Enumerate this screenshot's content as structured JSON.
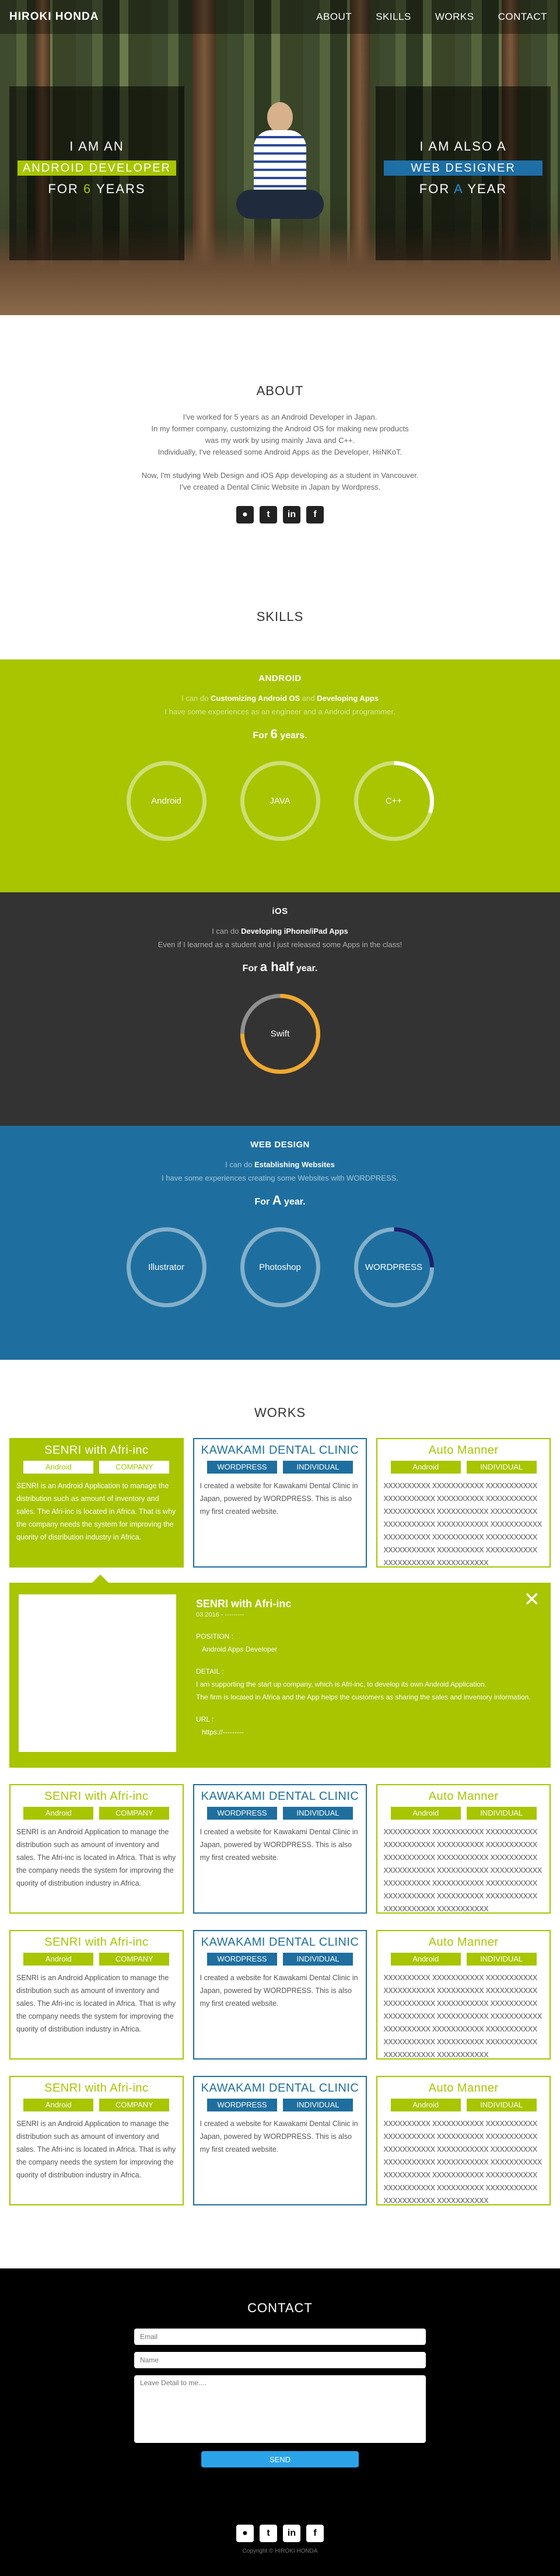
{
  "nav": {
    "brand": "HIROKI HONDA",
    "items": [
      "ABOUT",
      "SKILLS",
      "WORKS",
      "CONTACT"
    ]
  },
  "hero": {
    "left": {
      "line1": "I AM AN",
      "tag": "ANDROID DEVELOPER",
      "line3_pre": "FOR",
      "line3_hl": "6",
      "line3_post": "YEARS"
    },
    "right": {
      "line1": "I AM ALSO A",
      "tag": "WEB DESIGNER",
      "line3_pre": "FOR",
      "line3_hl": "A",
      "line3_post": "YEAR"
    }
  },
  "about": {
    "title": "ABOUT",
    "lines": [
      "I've worked for 5 years as an Android Developer in Japan.",
      "In my former company, customizing the Android OS for making new products",
      "was my work by using mainly Java and C++.",
      "Individually, I've released some Android Apps as the Developer, HiiNKoT.",
      "Now, I'm studying Web Design and iOS App developing as a student in Vancouver.",
      "I've created a Dental Clinic Website in Japan by Wordpress."
    ]
  },
  "social": {
    "github": "●",
    "twitter": "t",
    "linkedin": "in",
    "facebook": "f"
  },
  "skills": {
    "title": "SKILLS",
    "android": {
      "title": "ANDROID",
      "cando_pre": "I can do",
      "cando_a": "Customizing Android OS",
      "cando_and": "and",
      "cando_b": "Developing Apps",
      "exp": "I have some experiences as an engineer and a Android programmer.",
      "for": "For",
      "years": "6",
      "years_post": "years.",
      "circles": [
        {
          "label": "Android",
          "fill": 0
        },
        {
          "label": "JAVA",
          "fill": 0
        },
        {
          "label": "C++",
          "fill": 0.3
        }
      ]
    },
    "ios": {
      "title": "iOS",
      "cando_pre": "I can do",
      "cando_a": "Developing iPhone/iPad Apps",
      "exp": "Even if I learned as a student and I just released some Apps in the class!",
      "for": "For",
      "years": "a half",
      "years_post": "year.",
      "circles": [
        {
          "label": "Swift",
          "fill": 0.75
        }
      ]
    },
    "web": {
      "title": "WEB DESIGN",
      "cando_pre": "I can do",
      "cando_a": "Establishing Websites",
      "exp": "I have some experiences creating some Websites with WORDPRESS.",
      "for": "For",
      "years": "A",
      "years_post": "year.",
      "circles": [
        {
          "label": "Illustrator",
          "fill": 0
        },
        {
          "label": "Photoshop",
          "fill": 0
        },
        {
          "label": "WORDPRESS",
          "fill": 0.25
        }
      ]
    }
  },
  "works": {
    "title": "WORKS",
    "senri": {
      "title": "SENRI with Afri-inc",
      "tags": [
        "Android",
        "COMPANY"
      ],
      "desc": "SENRI is an Android Application to manage the distribution such as amount of inventory and sales. The Afri-inc is located in Africa. That is why the company needs the system for improving the quority of distribution industry in Africa."
    },
    "kawakami": {
      "title": "KAWAKAMI DENTAL CLINIC",
      "tags": [
        "WORDPRESS",
        "INDIVIDUAL"
      ],
      "desc": "I created a website for Kawakami Dental Clinic in Japan, powered by WORDPRESS. This is also my first created website."
    },
    "auto": {
      "title": "Auto Manner",
      "tags": [
        "Android",
        "INDIVIDUAL"
      ],
      "desc": "XXXXXXXXXX XXXXXXXXXXX XXXXXXXXXXX XXXXXXXXXXX XXXXXXXXXX XXXXXXXXXXX XXXXXXXXXXX XXXXXXXXXXX XXXXXXXXXX XXXXXXXXXXX XXXXXXXXXXX XXXXXXXXXXX XXXXXXXXXX XXXXXXXXXXX XXXXXXXXXXX XXXXXXXXXXX XXXXXXXXXX XXXXXXXXXXX XXXXXXXXXXX XXXXXXXXXXX"
    },
    "detail": {
      "title": "SENRI with Afri-inc",
      "date": "03.2016 - ---------",
      "position_label": "POSITION :",
      "position": "Android Apps Developer",
      "detail_label": "DETAIL :",
      "detail1": "I am supporting the start up company, which is Afri-inc, to develop its own Android Application.",
      "detail2": "The firm is located in Africa and the App helps the customers as sharing the sales and inventory information.",
      "url_label": "URL :",
      "url": "https://---------",
      "close": "✕"
    }
  },
  "contact": {
    "title": "CONTACT",
    "email_placeholder": "Email",
    "name_placeholder": "Name",
    "message_placeholder": "Leave Detail to me....",
    "send": "SEND",
    "copyright": "Copyright © HIROKI HONDA"
  }
}
